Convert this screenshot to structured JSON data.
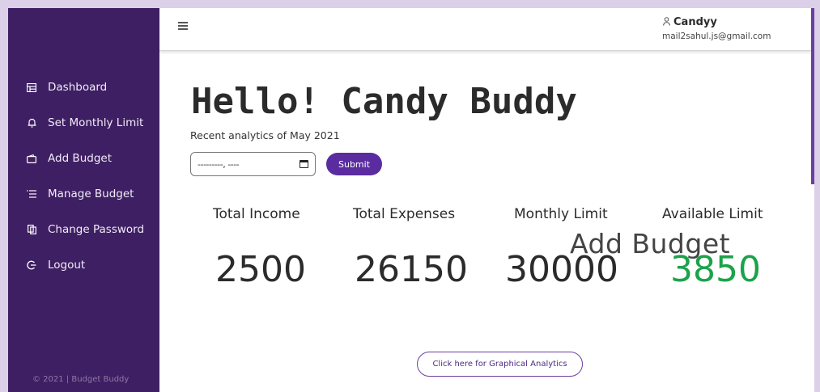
{
  "colors": {
    "sidebar": "#3f1f63",
    "accent": "#5b2ca0",
    "available": "#1aa34a",
    "background": "#dccfe8"
  },
  "sidebar": {
    "items": [
      {
        "label": "Dashboard",
        "icon": "dashboard-icon"
      },
      {
        "label": "Set Monthly Limit",
        "icon": "bell-icon"
      },
      {
        "label": "Add Budget",
        "icon": "wallet-icon"
      },
      {
        "label": "Manage Budget",
        "icon": "list-icon"
      },
      {
        "label": "Change Password",
        "icon": "copy-icon"
      },
      {
        "label": "Logout",
        "icon": "logout-icon"
      }
    ],
    "footer": "© 2021 | Budget Buddy"
  },
  "header": {
    "menu_icon": "hamburger-icon",
    "user_icon": "user-icon",
    "user_name": "Candyy",
    "user_email": "mail2sahul.js@gmail.com"
  },
  "main": {
    "greeting": "Hello! Candy Buddy",
    "subtitle": "Recent analytics of May 2021",
    "date_value": "---------, ----",
    "submit_label": "Submit",
    "overlay": "Add Budget",
    "stats": [
      {
        "label": "Total Income",
        "value": "2500"
      },
      {
        "label": "Total Expenses",
        "value": "26150"
      },
      {
        "label": "Monthly Limit",
        "value": "30000"
      },
      {
        "label": "Available Limit",
        "value": "3850"
      }
    ],
    "graph_button": "Click here for Graphical Analytics"
  }
}
